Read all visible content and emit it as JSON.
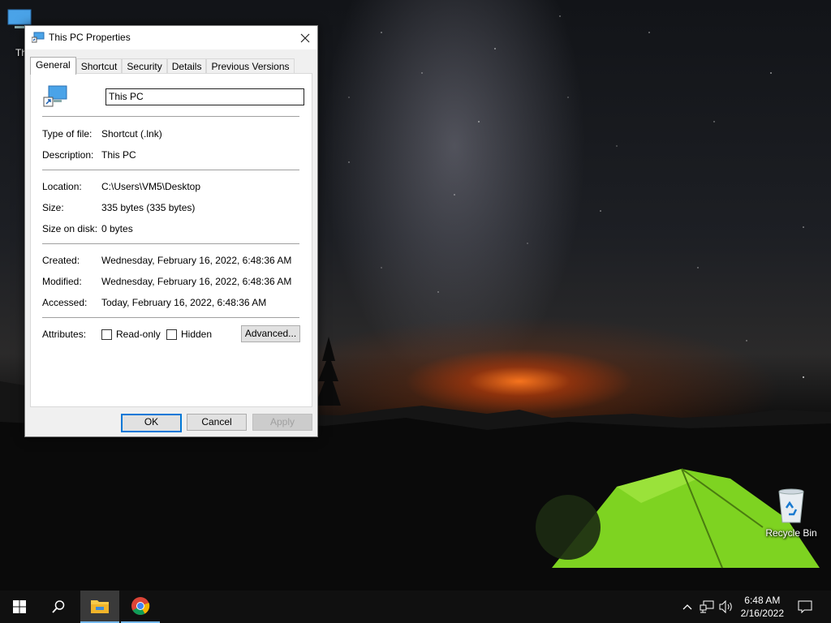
{
  "desktop": {
    "icon_this_pc_partial": "Th",
    "recycle_bin_label": "Recycle Bin"
  },
  "dialog": {
    "title": "This PC Properties",
    "tabs": [
      {
        "label": "General",
        "active": true
      },
      {
        "label": "Shortcut",
        "active": false
      },
      {
        "label": "Security",
        "active": false
      },
      {
        "label": "Details",
        "active": false
      },
      {
        "label": "Previous Versions",
        "active": false
      }
    ],
    "name_value": "This PC",
    "type_of_file": {
      "label": "Type of file:",
      "value": "Shortcut (.lnk)"
    },
    "description": {
      "label": "Description:",
      "value": "This PC"
    },
    "location": {
      "label": "Location:",
      "value": "C:\\Users\\VM5\\Desktop"
    },
    "size": {
      "label": "Size:",
      "value": "335 bytes (335 bytes)"
    },
    "size_on_disk": {
      "label": "Size on disk:",
      "value": "0 bytes"
    },
    "created": {
      "label": "Created:",
      "value": "Wednesday, February 16, 2022, 6:48:36 AM"
    },
    "modified": {
      "label": "Modified:",
      "value": "Wednesday, February 16, 2022, 6:48:36 AM"
    },
    "accessed": {
      "label": "Accessed:",
      "value": "Today, February 16, 2022, 6:48:36 AM"
    },
    "attributes": {
      "label": "Attributes:",
      "readonly": "Read-only",
      "readonly_checked": false,
      "hidden": "Hidden",
      "hidden_checked": false,
      "advanced_button": "Advanced..."
    },
    "buttons": {
      "ok": "OK",
      "cancel": "Cancel",
      "apply": "Apply"
    }
  },
  "taskbar": {
    "time": "6:48 AM",
    "date": "2/16/2022",
    "pinned": [
      "file-explorer",
      "chrome"
    ]
  },
  "colors": {
    "accent": "#0078d7",
    "taskbar": "#101010",
    "dialog_bg": "#f0f0f0"
  }
}
